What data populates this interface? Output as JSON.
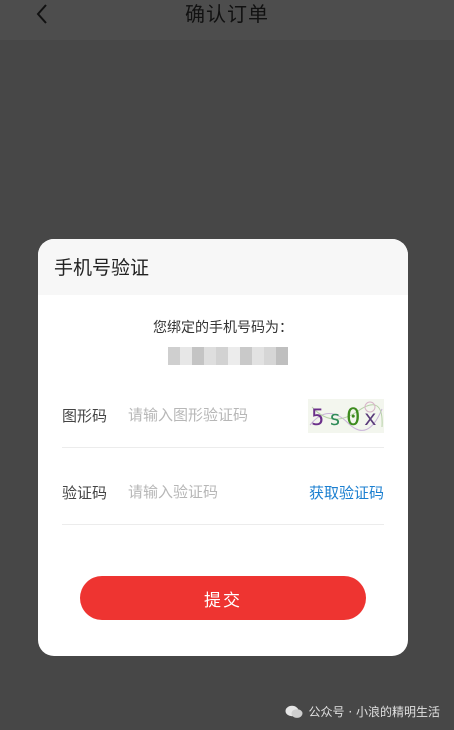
{
  "header": {
    "title": "确认订单",
    "back_icon": "chevron-left-icon"
  },
  "dialog": {
    "title": "手机号验证",
    "bound_phone_label": "您绑定的手机号码为：",
    "captcha_row": {
      "label": "图形码",
      "placeholder": "请输入图形验证码",
      "captcha_text": "5s0x"
    },
    "sms_row": {
      "label": "验证码",
      "placeholder": "请输入验证码",
      "get_code_label": "获取验证码"
    },
    "submit_label": "提交"
  },
  "watermark": {
    "text": "公众号 · 小浪的精明生活",
    "icon": "wechat-icon"
  },
  "colors": {
    "overlay_bg": "#474747",
    "submit_bg": "#ee3431",
    "link": "#1b7fd0"
  }
}
